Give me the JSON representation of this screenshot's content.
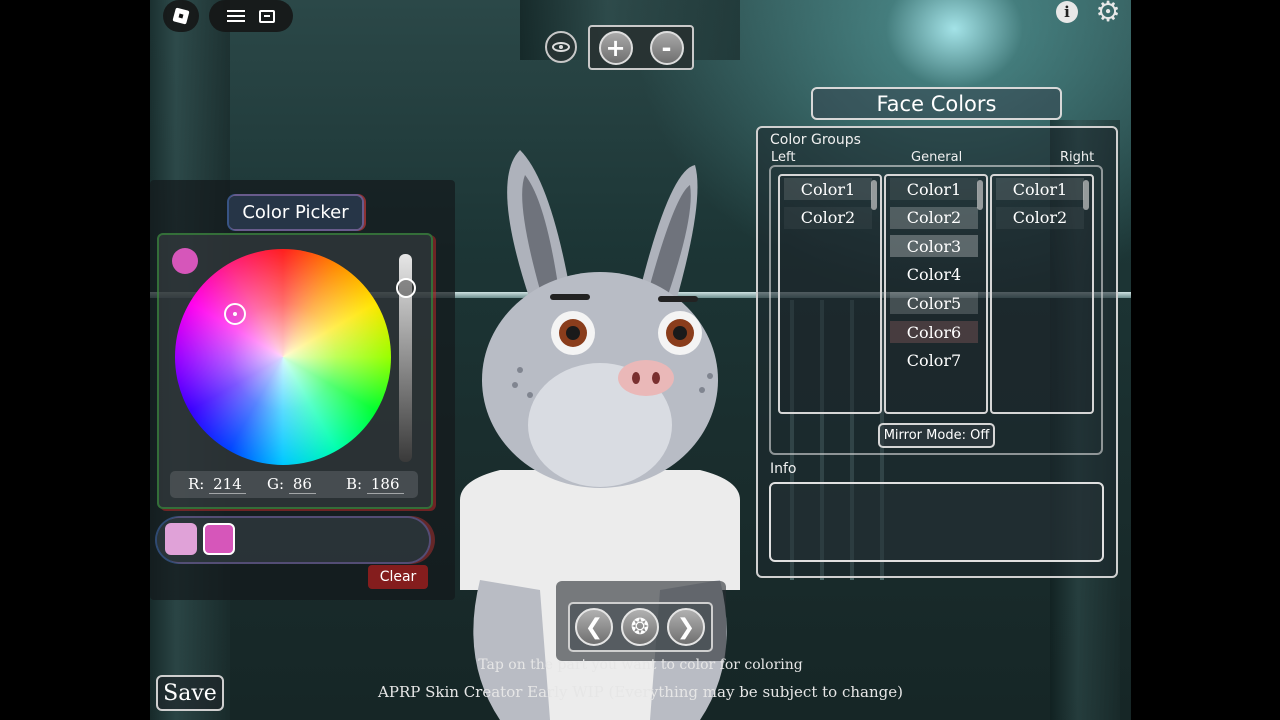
{
  "top_left": {
    "roblox_icon": "roblox-logo-icon",
    "menu_icon": "hamburger-icon",
    "chat_icon": "chat-icon"
  },
  "top_center": {
    "eye_icon": "eye-icon",
    "zoom_in": "+",
    "zoom_out": "-"
  },
  "top_right": {
    "info_icon": "i",
    "gear_icon": "⚙"
  },
  "color_picker": {
    "title": "Color Picker",
    "current_color": "#d656ba",
    "rgb": {
      "r_label": "R:",
      "r_value": "214",
      "g_label": "G:",
      "g_value": "86",
      "b_label": "B:",
      "b_value": "186"
    },
    "swatches": [
      "#e0a2d8",
      "#d656ba"
    ],
    "clear_label": "Clear"
  },
  "face_colors": {
    "title": "Face Colors",
    "groups_label": "Color Groups",
    "left_label": "Left",
    "general_label": "General",
    "right_label": "Right",
    "left_items": [
      "Color1",
      "Color2"
    ],
    "general_items": [
      "Color1",
      "Color2",
      "Color3",
      "Color4",
      "Color5",
      "Color6",
      "Color7"
    ],
    "right_items": [
      "Color1",
      "Color2"
    ],
    "mirror_label": "Mirror Mode: Off",
    "info_label": "Info"
  },
  "bottom": {
    "prev_icon": "chevron-left-icon",
    "center_icon": "wheel-icon",
    "next_icon": "chevron-right-icon",
    "hint": "Tap on the part you want to color for coloring",
    "footer": "APRP Skin Creator Early WIP (Everything may be subject to change)",
    "save_label": "Save"
  }
}
